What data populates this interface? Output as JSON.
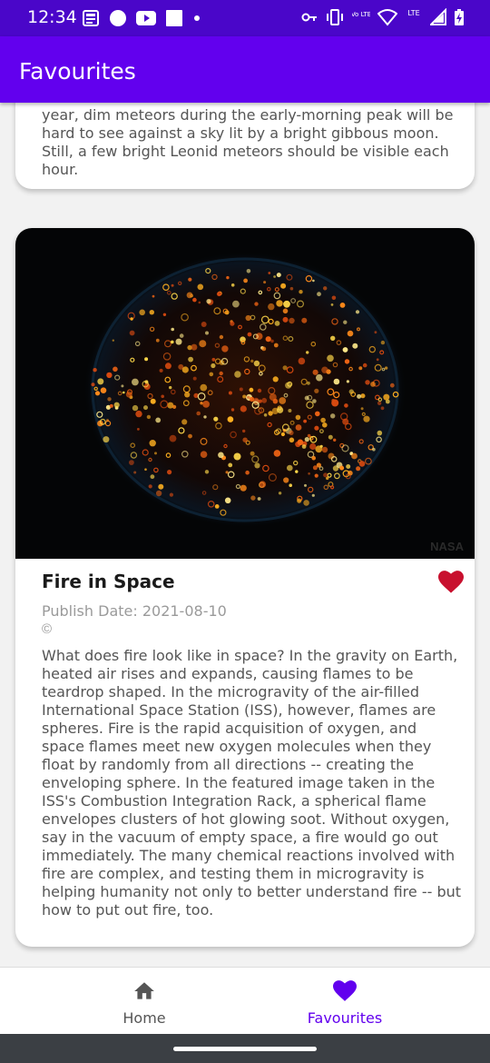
{
  "status_bar": {
    "time": "12:34",
    "left_icons": [
      "news-icon",
      "circle-icon",
      "youtube-icon",
      "square-icon",
      "dot-icon"
    ],
    "right_icons": [
      "vpn-key-icon",
      "vibrate-icon",
      "volte-icon",
      "wifi-icon",
      "lte-icon",
      "signal-icon",
      "battery-charging-icon"
    ],
    "volte_label": "Vo LTE",
    "lte_label": "LTE"
  },
  "app_bar": {
    "title": "Favourites"
  },
  "cards": [
    {
      "description": "year, dim meteors during the early-morning peak will be hard to see against a sky lit by a bright gibbous moon.  Still, a few bright Leonid meteors should be visible each hour."
    },
    {
      "image_credit": "NASA",
      "title": "Fire in Space",
      "publish_date": "Publish Date: 2021-08-10",
      "copyright": "©",
      "favourited": true,
      "description": "What does fire look like in space? In the gravity on Earth, heated air rises and expands, causing flames to be teardrop shaped. In the microgravity of the air-filled International Space Station (ISS), however, flames are spheres. Fire is the rapid acquisition of oxygen, and space flames meet new oxygen molecules when they float by randomly from all directions -- creating the enveloping sphere.  In the featured image taken in the ISS's Combustion Integration Rack, a spherical flame envelopes clusters of hot glowing soot.  Without oxygen, say in the vacuum of empty space, a fire would go out immediately.  The many chemical reactions involved with fire are complex, and testing them in microgravity is helping humanity not only to better understand fire -- but how to put out fire, too."
    }
  ],
  "bottom_nav": {
    "items": [
      {
        "label": "Home",
        "icon": "home-icon",
        "active": false
      },
      {
        "label": "Favourites",
        "icon": "heart-icon",
        "active": true
      }
    ]
  },
  "colors": {
    "primary": "#6200ee",
    "status_bar": "#4a06c9",
    "favourite_heart": "#c8102e",
    "nav_inactive": "#555555"
  }
}
